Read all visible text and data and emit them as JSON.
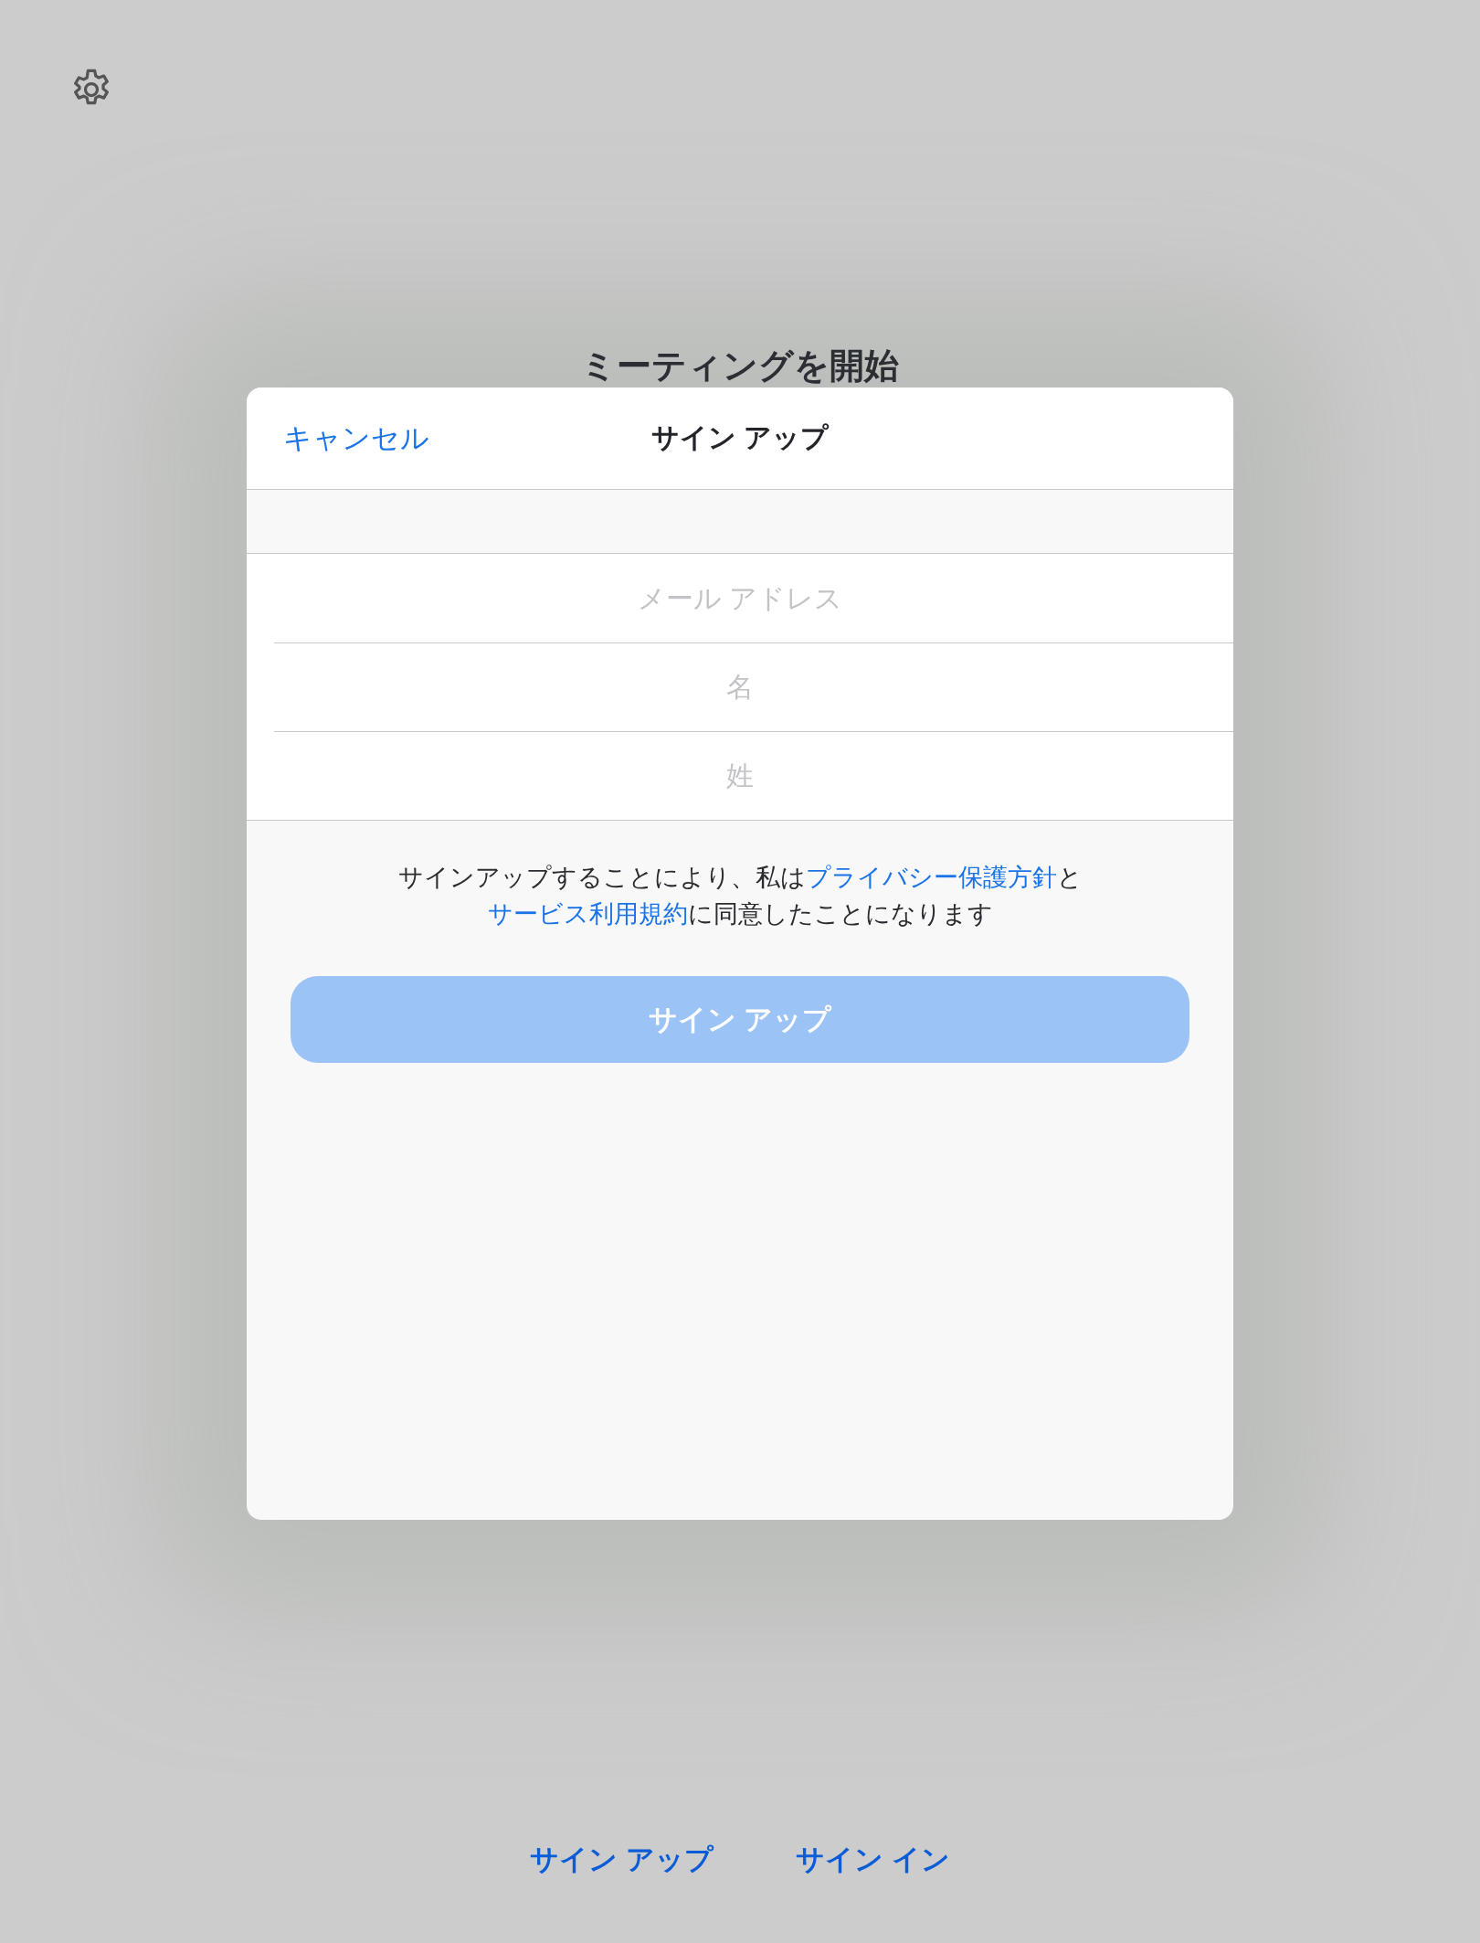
{
  "background_title": "ミーティングを開始",
  "dialog": {
    "cancel": "キャンセル",
    "title": "サイン アップ",
    "fields": [
      {
        "placeholder": "メール アドレス"
      },
      {
        "placeholder": "名"
      },
      {
        "placeholder": "姓"
      }
    ],
    "consent": [
      {
        "text": "サインアップすることにより、私は",
        "link": false
      },
      {
        "text": "プライバシー保護方針",
        "link": true
      },
      {
        "text": "と",
        "link": false
      },
      {
        "text": "サービス利用規約",
        "link": true
      },
      {
        "text": "に同意したことになります",
        "link": false
      }
    ],
    "submit": {
      "label": "サイン アップ",
      "disabled": true
    }
  },
  "bottom_links": [
    "サイン アップ",
    "サイン イン"
  ]
}
